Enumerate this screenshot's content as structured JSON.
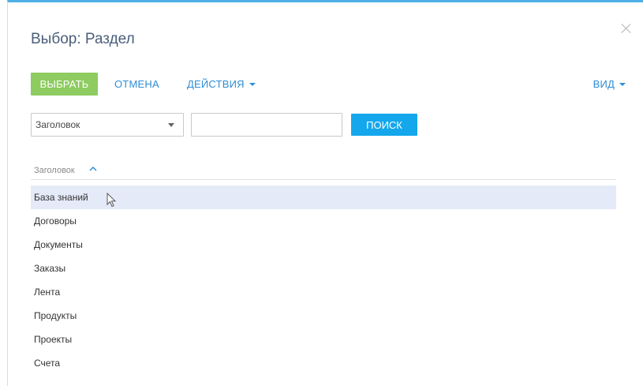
{
  "dialog": {
    "title": "Выбор: Раздел"
  },
  "toolbar": {
    "select_label": "ВЫБРАТЬ",
    "cancel_label": "ОТМЕНА",
    "actions_label": "ДЕЙСТВИЯ",
    "view_label": "ВИД"
  },
  "filter": {
    "column_selected": "Заголовок",
    "search_value": "",
    "search_button_label": "ПОИСК"
  },
  "grid": {
    "column_header": "Заголовок",
    "sort": "ascending",
    "rows": [
      {
        "title": "База знаний",
        "selected": true
      },
      {
        "title": "Договоры",
        "selected": false
      },
      {
        "title": "Документы",
        "selected": false
      },
      {
        "title": "Заказы",
        "selected": false
      },
      {
        "title": "Лента",
        "selected": false
      },
      {
        "title": "Продукты",
        "selected": false
      },
      {
        "title": "Проекты",
        "selected": false
      },
      {
        "title": "Счета",
        "selected": false
      }
    ]
  },
  "icons": {
    "close": "close-icon",
    "caret": "caret-down-icon",
    "sort": "sort-ascending-icon",
    "cursor": "mouse-pointer-icon"
  },
  "colors": {
    "accent_top_border": "#4fb0e5",
    "select_button": "#8ecb60",
    "search_button": "#15a7ec",
    "link": "#2e8dd6",
    "selected_row": "#e4eaf7",
    "title": "#4b5e7a"
  }
}
